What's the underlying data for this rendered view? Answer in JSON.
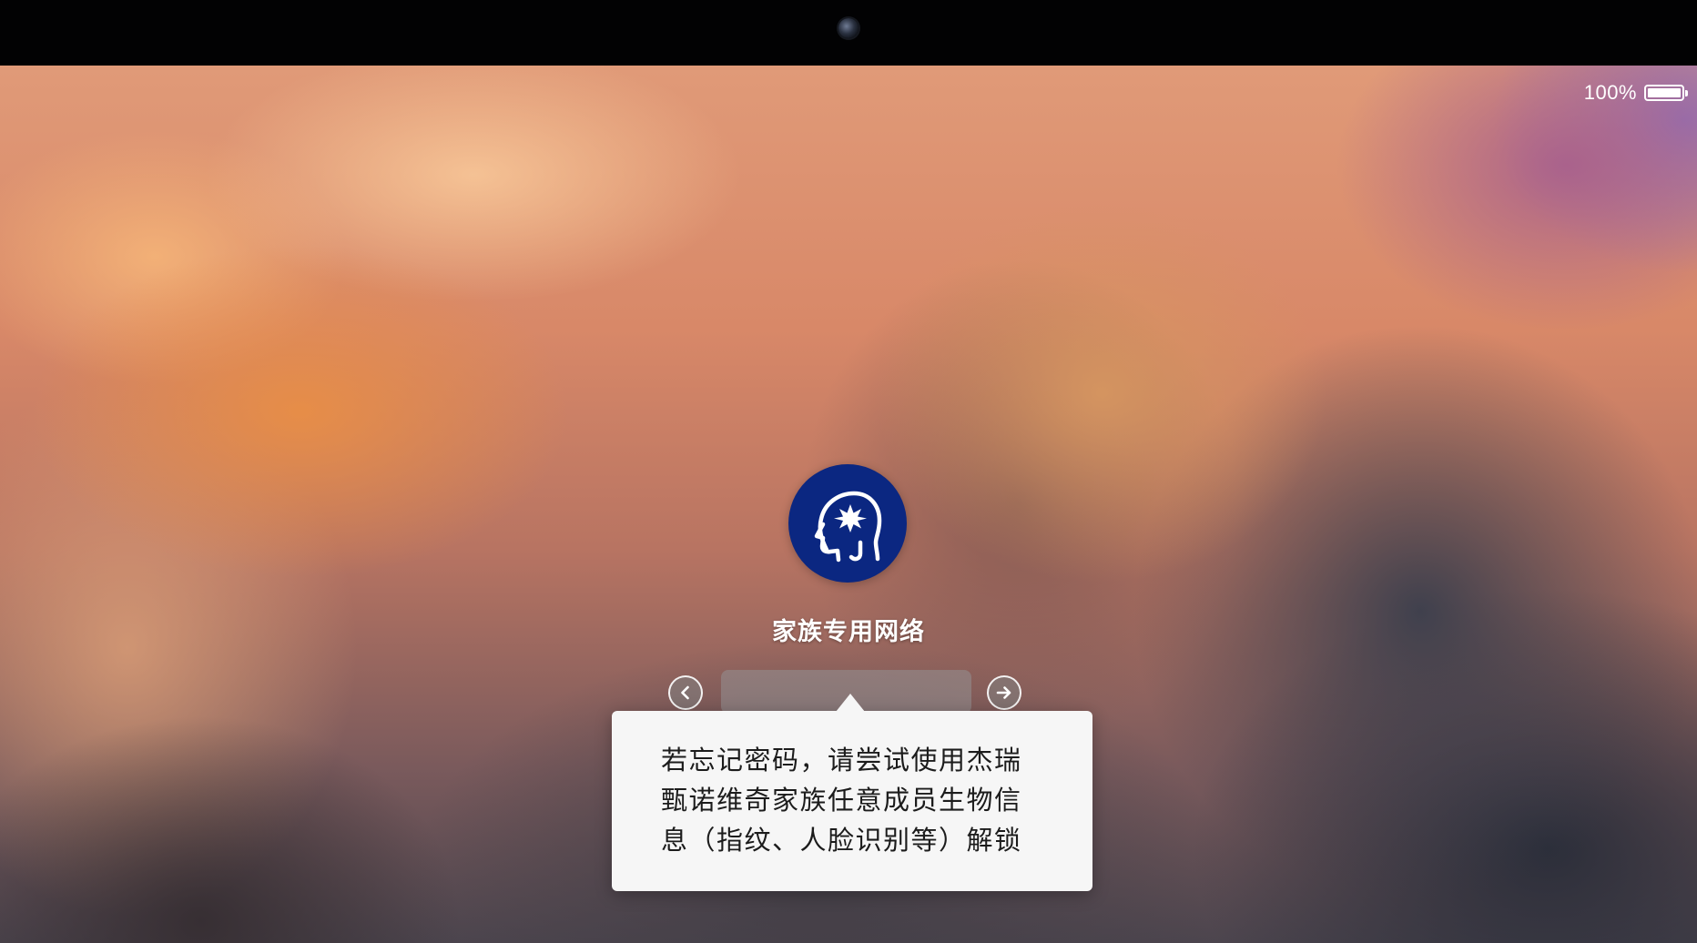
{
  "status_bar": {
    "battery_percent_label": "100%",
    "battery_level": 1.0
  },
  "login": {
    "username": "家族专用网络",
    "avatar_icon": "head-with-star-icon",
    "password_value": "",
    "back_icon": "chevron-left-icon",
    "submit_icon": "arrow-right-icon"
  },
  "hint": {
    "text": "若忘记密码，请尝试使用杰瑞甄诺维奇家族任意成员生物信息（指纹、人脸识别等）解锁"
  },
  "colors": {
    "avatar_bg": "#0b2781",
    "tooltip_bg": "#f6f6f6",
    "text_light": "#ffffff",
    "text_dark": "#1c1c1c"
  }
}
